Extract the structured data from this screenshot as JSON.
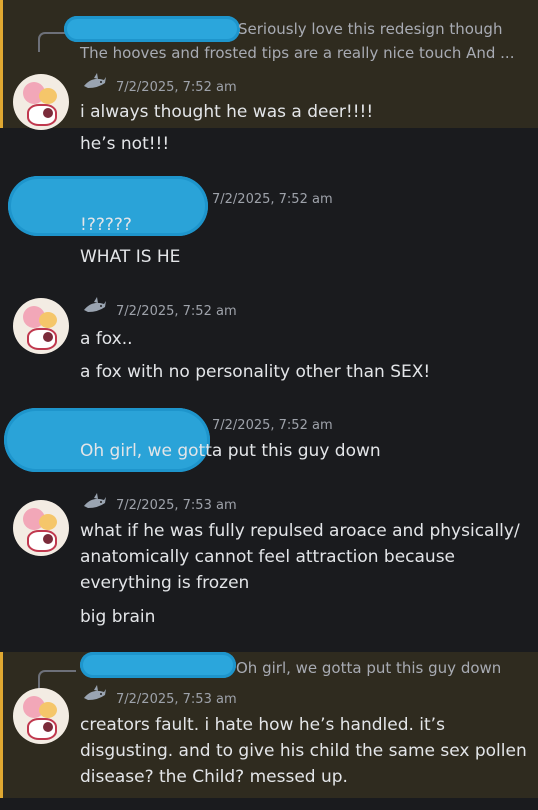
{
  "messages": [
    {
      "highlighted": true,
      "reply_preview": {
        "line1": "Seriously love this redesign though",
        "line2": "The hooves and frosted tips are a really nice touch And ..."
      },
      "timestamp": "7/2/2025, 7:52 am",
      "lines": [
        "i always thought he was a deer!!!!",
        "he’s not!!!"
      ]
    },
    {
      "highlighted": false,
      "timestamp": "7/2/2025, 7:52 am",
      "lines": [
        "!?????",
        "WHAT IS HE"
      ]
    },
    {
      "highlighted": false,
      "timestamp": "7/2/2025, 7:52 am",
      "lines": [
        "a fox..",
        "a fox with no personality other than SEX!"
      ]
    },
    {
      "highlighted": false,
      "timestamp": "7/2/2025, 7:52 am",
      "lines": [
        "Oh girl, we gotta put this guy down"
      ]
    },
    {
      "highlighted": false,
      "timestamp": "7/2/2025, 7:53 am",
      "lines": [
        "what if he was fully repulsed aroace and physically/",
        "anatomically cannot feel attraction because",
        "everything is frozen",
        "big brain"
      ]
    },
    {
      "highlighted": true,
      "reply_preview": {
        "line1": "Oh girl, we gotta put this guy down"
      },
      "timestamp": "7/2/2025, 7:53 am",
      "lines": [
        "creators fault. i hate how he’s handled. it’s",
        "disgusting. and to give his child the same sex pollen",
        "disease? the Child? messed up."
      ]
    }
  ],
  "icons": {
    "author_badge": "shark-icon",
    "reply": "reply-connector-icon"
  },
  "colors": {
    "highlight_bg": "#2f2b1f",
    "highlight_bar": "#e0a831",
    "background": "#1a1b1e",
    "redaction": "#2aa3d8"
  }
}
